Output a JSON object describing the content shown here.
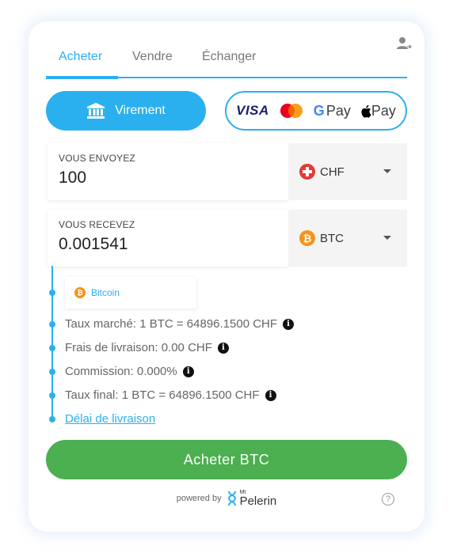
{
  "tabs": [
    {
      "label": "Acheter",
      "active": true
    },
    {
      "label": "Vendre",
      "active": false
    },
    {
      "label": "Échanger",
      "active": false
    }
  ],
  "payment": {
    "virement_label": "Virement",
    "visa_label": "VISA",
    "gpay_label": "Pay",
    "apple_label": "Pay"
  },
  "send": {
    "label": "VOUS ENVOYEZ",
    "value": "100",
    "currency": "CHF"
  },
  "receive": {
    "label": "VOUS RECEVEZ",
    "value": "0.001541",
    "currency": "BTC"
  },
  "network": {
    "label": "Bitcoin"
  },
  "info": {
    "market_rate": "Taux marché: 1 BTC = 64896.1500 CHF",
    "delivery_fee": "Frais de livraison: 0.00 CHF",
    "commission": "Commission: 0.000%",
    "final_rate": "Taux final: 1 BTC = 64896.1500 CHF",
    "delivery_time": "Délai de livraison"
  },
  "buy_button": "Acheter BTC",
  "footer": {
    "powered_by": "powered by",
    "brand_small": "Mt",
    "brand_name": "Pelerin",
    "help": "?"
  },
  "colors": {
    "accent": "#2bb0ef",
    "buy": "#4caf50"
  },
  "icons": [
    "user-icon",
    "bank-icon",
    "visa-logo",
    "mastercard-logo",
    "google-pay-logo",
    "apple-pay-logo",
    "swiss-flag-icon",
    "bitcoin-icon",
    "info-icon",
    "help-icon"
  ]
}
